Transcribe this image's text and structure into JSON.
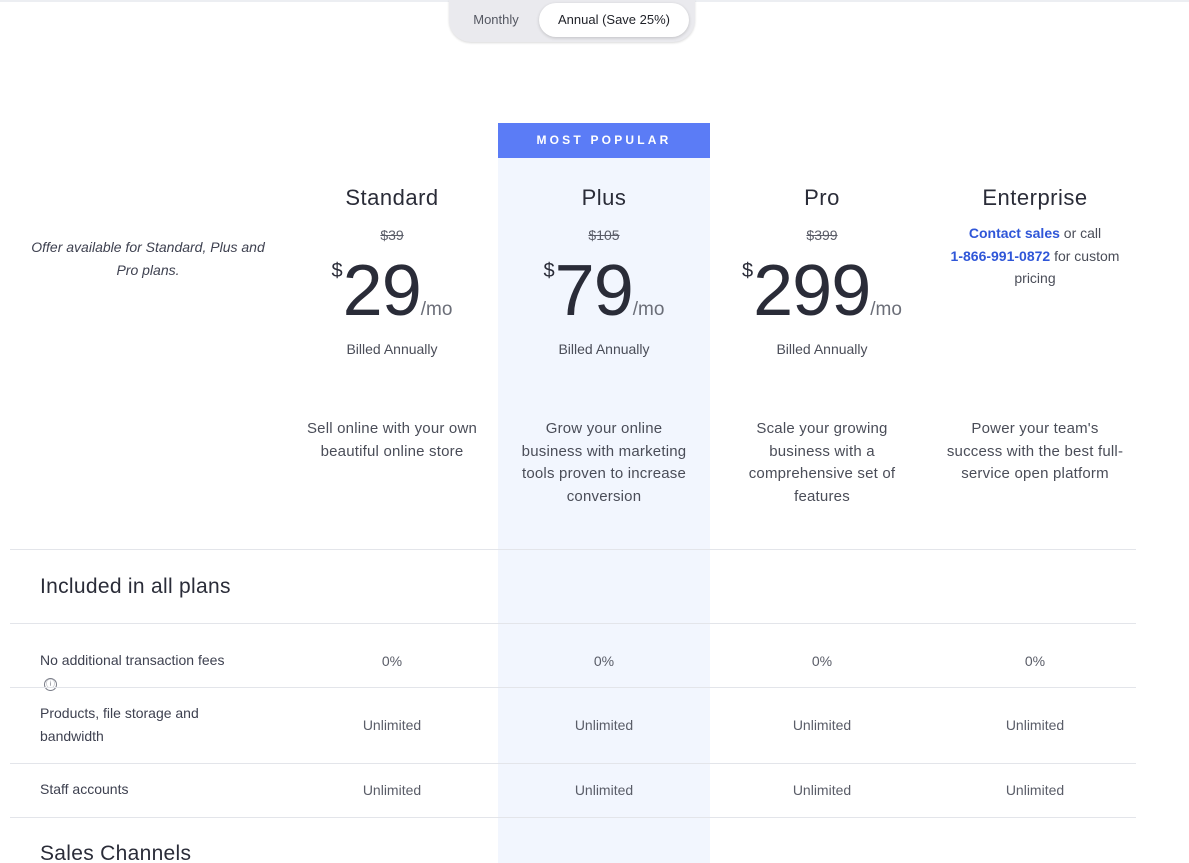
{
  "toggle": {
    "monthly_label": "Monthly",
    "annual_label": "Annual (Save 25%)"
  },
  "badge": "MOST POPULAR",
  "offer_note": "Offer available for Standard, Plus and Pro plans.",
  "plans": [
    {
      "name": "Standard",
      "old_price": "$39",
      "currency": "$",
      "amount": "29",
      "per": "/mo",
      "billed": "Billed Annually",
      "description": "Sell online with your own beautiful online store"
    },
    {
      "name": "Plus",
      "old_price": "$105",
      "currency": "$",
      "amount": "79",
      "per": "/mo",
      "billed": "Billed Annually",
      "description": "Grow your online business with marketing tools proven to increase conversion"
    },
    {
      "name": "Pro",
      "old_price": "$399",
      "currency": "$",
      "amount": "299",
      "per": "/mo",
      "billed": "Billed Annually",
      "description": "Scale your growing business with a comprehensive set of features"
    },
    {
      "name": "Enterprise",
      "contact_link": "Contact sales",
      "contact_mid": " or call ",
      "phone": "1-866-991-0872",
      "contact_tail": " for custom pricing",
      "description": "Power your team's success with the best full-service open platform"
    }
  ],
  "sections": {
    "included_title": "Included in all plans",
    "sales_title": "Sales Channels"
  },
  "features": [
    {
      "label": "No additional transaction fees",
      "info_icon": "ⓘ",
      "values": [
        "0%",
        "0%",
        "0%",
        "0%"
      ]
    },
    {
      "label": "Products, file storage and bandwidth",
      "values": [
        "Unlimited",
        "Unlimited",
        "Unlimited",
        "Unlimited"
      ]
    },
    {
      "label": "Staff accounts",
      "values": [
        "Unlimited",
        "Unlimited",
        "Unlimited",
        "Unlimited"
      ]
    }
  ],
  "colors": {
    "accent": "#5b7cf6",
    "highlight_bg": "#f2f6fe",
    "link": "#2f56d8"
  }
}
